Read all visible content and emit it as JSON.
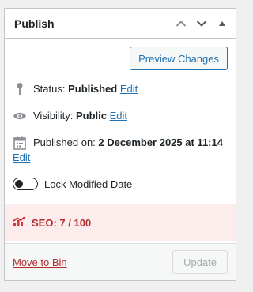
{
  "header": {
    "title": "Publish"
  },
  "preview": {
    "label": "Preview Changes"
  },
  "status": {
    "label": "Status:",
    "value": "Published",
    "edit": "Edit"
  },
  "visibility": {
    "label": "Visibility:",
    "value": "Public",
    "edit": "Edit"
  },
  "published": {
    "label": "Published on:",
    "value": "2 December 2025 at 11:14",
    "edit": "Edit"
  },
  "lock": {
    "label": "Lock Modified Date",
    "enabled": false
  },
  "seo": {
    "label": "SEO: 7 / 100",
    "color": "#b32d2e"
  },
  "footer": {
    "trash": "Move to Bin",
    "update": "Update"
  },
  "icons": [
    "chevron-up-icon",
    "chevron-down-icon",
    "collapse-triangle-icon",
    "pin-icon",
    "eye-icon",
    "calendar-icon",
    "seo-chart-icon"
  ]
}
